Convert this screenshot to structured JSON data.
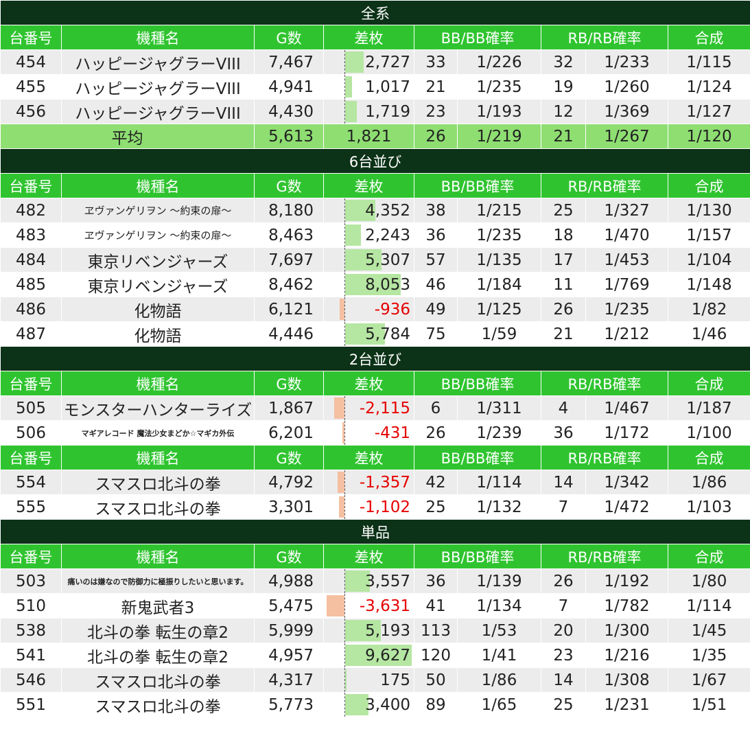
{
  "columns": [
    "台番号",
    "機種名",
    "G数",
    "差枚",
    "BB/BB確率",
    "RB/RB確率",
    "合成"
  ],
  "diff_scale_max": 9627,
  "colors": {
    "section_bg": "#0c3217",
    "header_bg": "#2fc42f",
    "average_bg": "#8ede72",
    "positive_bar": "#b5e6a2",
    "negative_bar": "#f5bfa1",
    "negative_text": "#e60000"
  },
  "sections": [
    {
      "title": "全系",
      "groups": [
        {
          "rows": [
            {
              "no": "454",
              "name": "ハッピージャグラーVIII",
              "games": "7,467",
              "diff": "2,727",
              "diff_value": 2727,
              "bb": "33",
              "bb_rate": "1/226",
              "rb": "32",
              "rb_rate": "1/233",
              "combined": "1/115"
            },
            {
              "no": "455",
              "name": "ハッピージャグラーVIII",
              "games": "4,941",
              "diff": "1,017",
              "diff_value": 1017,
              "bb": "21",
              "bb_rate": "1/235",
              "rb": "19",
              "rb_rate": "1/260",
              "combined": "1/124"
            },
            {
              "no": "456",
              "name": "ハッピージャグラーVIII",
              "games": "4,430",
              "diff": "1,719",
              "diff_value": 1719,
              "bb": "23",
              "bb_rate": "1/193",
              "rb": "12",
              "rb_rate": "1/369",
              "combined": "1/127"
            }
          ]
        }
      ],
      "average": {
        "label": "平均",
        "games": "5,613",
        "diff": "1,821",
        "bb": "26",
        "bb_rate": "1/219",
        "rb": "21",
        "rb_rate": "1/267",
        "combined": "1/120"
      }
    },
    {
      "title": "6台並び",
      "groups": [
        {
          "rows": [
            {
              "no": "482",
              "name": "ヱヴァンゲリヲン ～約束の扉～",
              "games": "8,180",
              "diff": "4,352",
              "diff_value": 4352,
              "bb": "38",
              "bb_rate": "1/215",
              "rb": "25",
              "rb_rate": "1/327",
              "combined": "1/130"
            },
            {
              "no": "483",
              "name": "ヱヴァンゲリヲン ～約束の扉～",
              "games": "8,463",
              "diff": "2,243",
              "diff_value": 2243,
              "bb": "36",
              "bb_rate": "1/235",
              "rb": "18",
              "rb_rate": "1/470",
              "combined": "1/157"
            },
            {
              "no": "484",
              "name": "東京リベンジャーズ",
              "games": "7,697",
              "diff": "5,307",
              "diff_value": 5307,
              "bb": "57",
              "bb_rate": "1/135",
              "rb": "17",
              "rb_rate": "1/453",
              "combined": "1/104"
            },
            {
              "no": "485",
              "name": "東京リベンジャーズ",
              "games": "8,462",
              "diff": "8,053",
              "diff_value": 8053,
              "bb": "46",
              "bb_rate": "1/184",
              "rb": "11",
              "rb_rate": "1/769",
              "combined": "1/148"
            },
            {
              "no": "486",
              "name": "化物語",
              "games": "6,121",
              "diff": "-936",
              "diff_value": -936,
              "bb": "49",
              "bb_rate": "1/125",
              "rb": "26",
              "rb_rate": "1/235",
              "combined": "1/82"
            },
            {
              "no": "487",
              "name": "化物語",
              "games": "4,446",
              "diff": "5,784",
              "diff_value": 5784,
              "bb": "75",
              "bb_rate": "1/59",
              "rb": "21",
              "rb_rate": "1/212",
              "combined": "1/46"
            }
          ]
        }
      ]
    },
    {
      "title": "2台並び",
      "groups": [
        {
          "rows": [
            {
              "no": "505",
              "name": "モンスターハンターライズ",
              "games": "1,867",
              "diff": "-2,115",
              "diff_value": -2115,
              "bb": "6",
              "bb_rate": "1/311",
              "rb": "4",
              "rb_rate": "1/467",
              "combined": "1/187"
            },
            {
              "no": "506",
              "name": "マギアレコード 魔法少女まどか☆マギカ外伝",
              "games": "6,201",
              "diff": "-431",
              "diff_value": -431,
              "bb": "26",
              "bb_rate": "1/239",
              "rb": "36",
              "rb_rate": "1/172",
              "combined": "1/100"
            }
          ]
        },
        {
          "rows": [
            {
              "no": "554",
              "name": "スマスロ北斗の拳",
              "games": "4,792",
              "diff": "-1,357",
              "diff_value": -1357,
              "bb": "42",
              "bb_rate": "1/114",
              "rb": "14",
              "rb_rate": "1/342",
              "combined": "1/86"
            },
            {
              "no": "555",
              "name": "スマスロ北斗の拳",
              "games": "3,301",
              "diff": "-1,102",
              "diff_value": -1102,
              "bb": "25",
              "bb_rate": "1/132",
              "rb": "7",
              "rb_rate": "1/472",
              "combined": "1/103"
            }
          ]
        }
      ]
    },
    {
      "title": "単品",
      "groups": [
        {
          "rows": [
            {
              "no": "503",
              "name": "痛いのは嫌なので防御力に極振りしたいと思います。",
              "games": "4,988",
              "diff": "3,557",
              "diff_value": 3557,
              "bb": "36",
              "bb_rate": "1/139",
              "rb": "26",
              "rb_rate": "1/192",
              "combined": "1/80"
            },
            {
              "no": "510",
              "name": "新鬼武者3",
              "games": "5,475",
              "diff": "-3,631",
              "diff_value": -3631,
              "bb": "41",
              "bb_rate": "1/134",
              "rb": "7",
              "rb_rate": "1/782",
              "combined": "1/114"
            },
            {
              "no": "538",
              "name": "北斗の拳 転生の章2",
              "games": "5,999",
              "diff": "5,193",
              "diff_value": 5193,
              "bb": "113",
              "bb_rate": "1/53",
              "rb": "20",
              "rb_rate": "1/300",
              "combined": "1/45"
            },
            {
              "no": "541",
              "name": "北斗の拳 転生の章2",
              "games": "4,957",
              "diff": "9,627",
              "diff_value": 9627,
              "bb": "120",
              "bb_rate": "1/41",
              "rb": "23",
              "rb_rate": "1/216",
              "combined": "1/35"
            },
            {
              "no": "546",
              "name": "スマスロ北斗の拳",
              "games": "4,317",
              "diff": "175",
              "diff_value": 175,
              "bb": "50",
              "bb_rate": "1/86",
              "rb": "14",
              "rb_rate": "1/308",
              "combined": "1/67"
            },
            {
              "no": "551",
              "name": "スマスロ北斗の拳",
              "games": "5,773",
              "diff": "3,400",
              "diff_value": 3400,
              "bb": "89",
              "bb_rate": "1/65",
              "rb": "25",
              "rb_rate": "1/231",
              "combined": "1/51"
            }
          ]
        }
      ]
    }
  ]
}
